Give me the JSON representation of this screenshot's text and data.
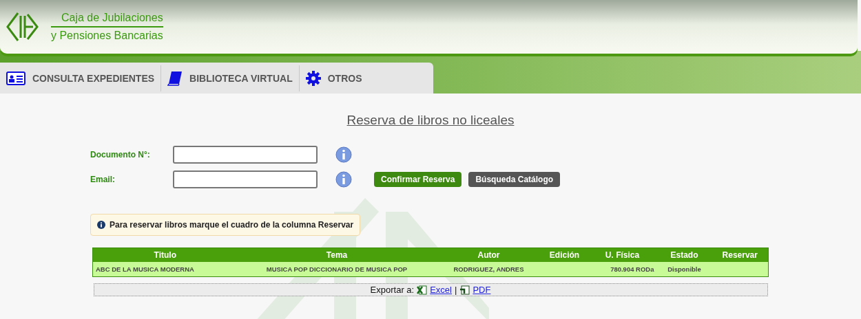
{
  "header": {
    "org_line_1": "Caja de Jubilaciones",
    "org_line_2": "y Pensiones Bancarias"
  },
  "nav": [
    {
      "label": "CONSULTA EXPEDIENTES",
      "kind": "card"
    },
    {
      "label": "BIBLIOTECA VIRTUAL",
      "kind": "book"
    },
    {
      "label": "OTROS",
      "kind": "gear"
    }
  ],
  "page_title": "Reserva de libros no liceales",
  "form": {
    "fields": [
      {
        "label": "Documento N°:"
      },
      {
        "label": "Email:"
      }
    ],
    "buttons": [
      {
        "label": "Confirmar Reserva",
        "kind": "primary"
      },
      {
        "label": "Búsqueda Catálogo",
        "kind": "secondary"
      }
    ]
  },
  "notice": "Para reservar libros marque el cuadro de la columna Reservar",
  "table": {
    "columns": [
      "Titulo",
      "Tema",
      "Autor",
      "Edición",
      "U. Física",
      "Estado",
      "Reservar"
    ],
    "rows": [
      [
        "ABC DE LA MUSICA MODERNA",
        "MUSICA POP DICCIONARIO DE MUSICA POP",
        "RODRIGUEZ, ANDRES",
        "",
        "780.904 RODa",
        "Disponible",
        ""
      ]
    ]
  },
  "export": {
    "label": "Exportar a:",
    "links": [
      {
        "label": "Excel",
        "kind": "excel"
      },
      {
        "label": "PDF",
        "kind": "pdf"
      }
    ],
    "separator": "|"
  }
}
